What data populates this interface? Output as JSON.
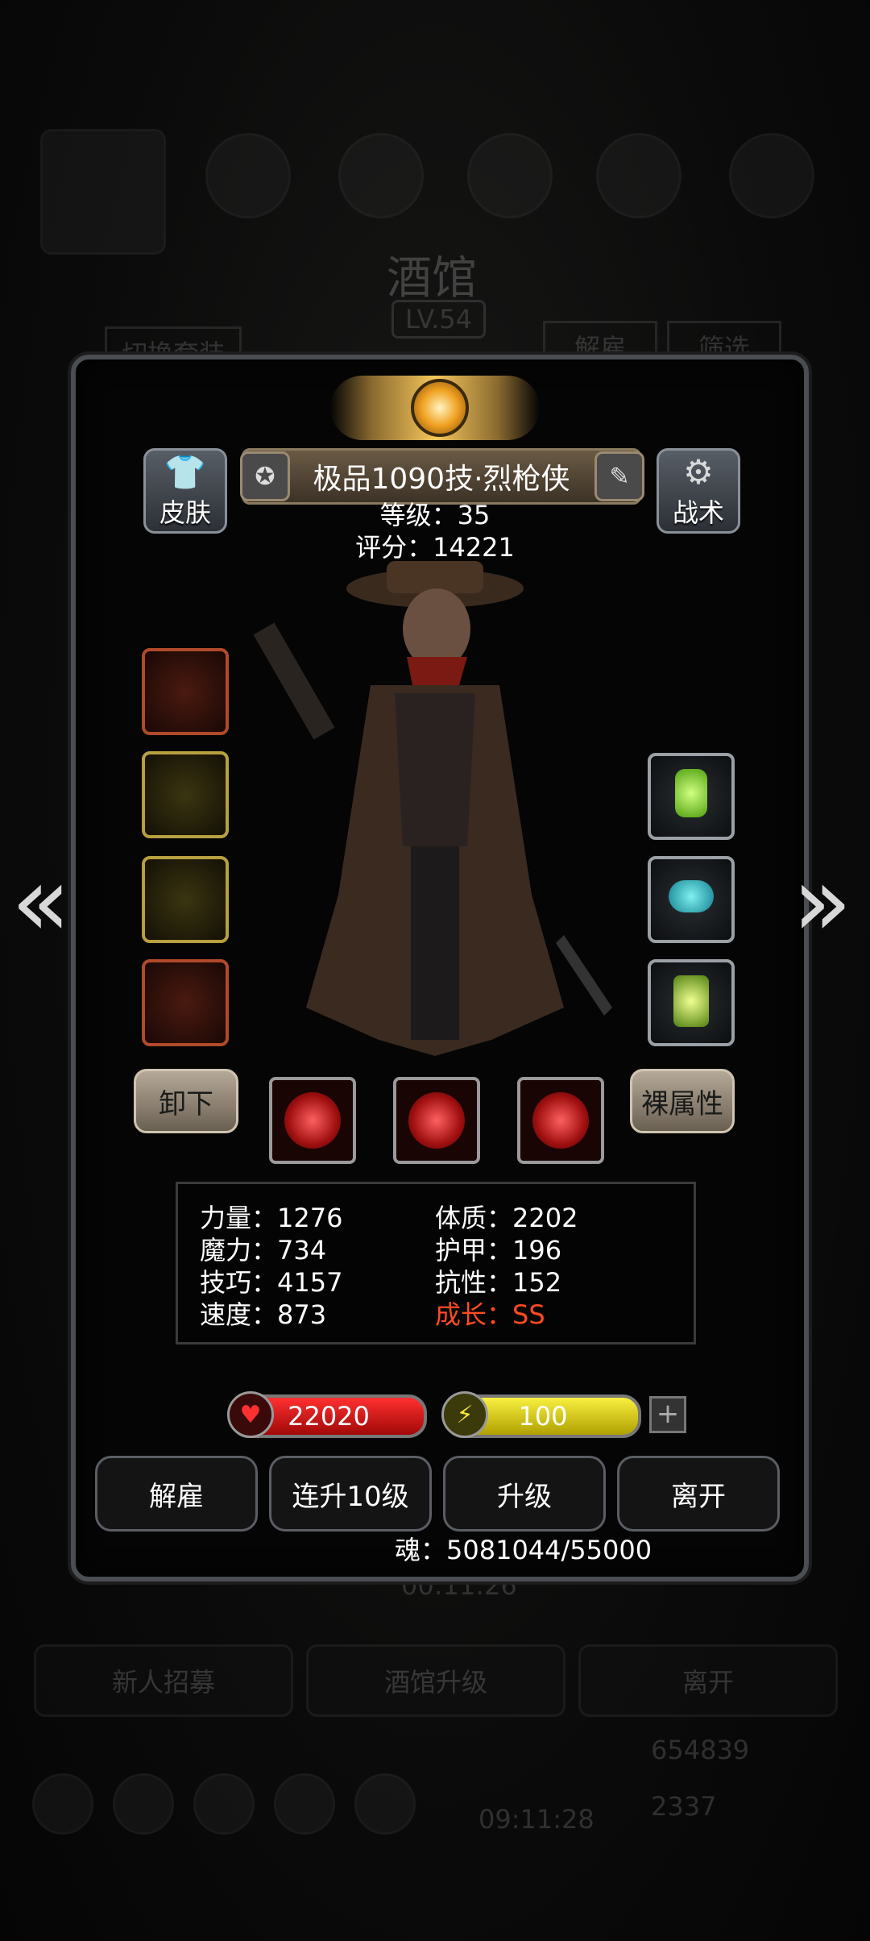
{
  "background": {
    "tavern_title": "酒馆",
    "tavern_level": "LV.54",
    "switch_outfit": "切换套装",
    "dismiss": "解雇",
    "filter": "筛选",
    "timer_1": "00:11:26",
    "timer_2": "09:11:28",
    "recruit": "新人招募",
    "tavern_upgrade": "酒馆升级",
    "leave": "离开",
    "gold_count": "654839",
    "gem_count": "2337"
  },
  "hero": {
    "name": "极品1090技·烈枪侠",
    "level_text": "等级：35",
    "score_text": "评分：14221"
  },
  "buttons": {
    "skin": "皮肤",
    "tactics": "战术",
    "unequip": "卸下",
    "base_attrs": "裸属性"
  },
  "attributes": {
    "strength": "力量：1276",
    "magic": "魔力：734",
    "skill": "技巧：4157",
    "speed": "速度：873",
    "constitution": "体质：2202",
    "armor": "护甲：196",
    "resistance": "抗性：152",
    "growth": "成长：SS"
  },
  "resources": {
    "hp": "22020",
    "energy": "100",
    "add": "+"
  },
  "actions": {
    "dismiss": "解雇",
    "upgrade10": "连升10级",
    "upgrade": "升级",
    "leave": "离开"
  },
  "soul": "魂：5081044/55000",
  "arrows": {
    "left": "«",
    "right": "»"
  },
  "colors": {
    "growth": "#ff4a22",
    "hp_bar": "#c01414",
    "energy_bar": "#e0d018"
  }
}
